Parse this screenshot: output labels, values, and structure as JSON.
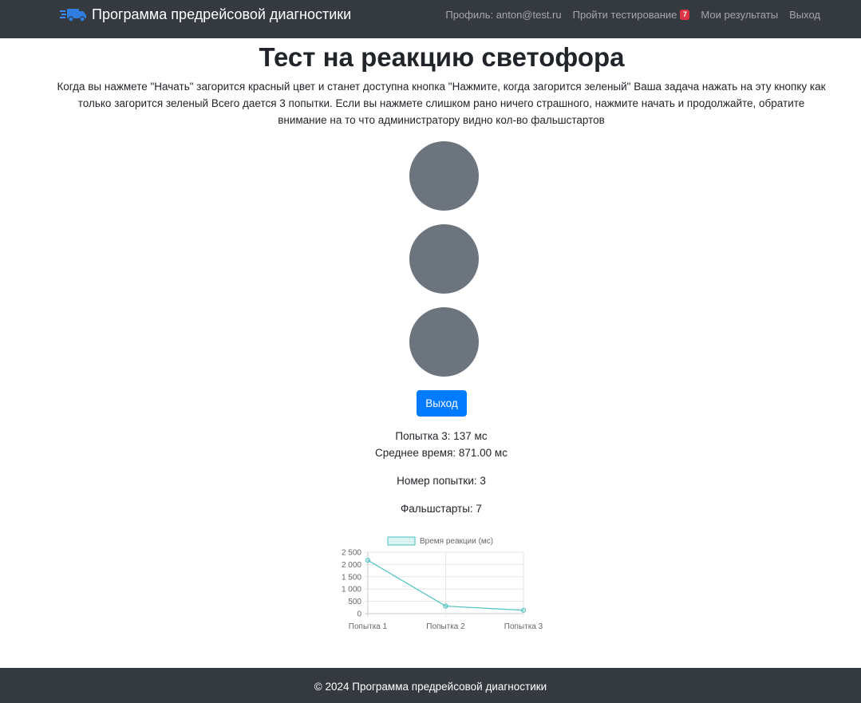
{
  "navbar": {
    "brand": "Программа предрейсовой диагностики",
    "brand_icon": "truck-icon",
    "profile": "Профиль: anton@test.ru",
    "take_test": "Пройти тестирование",
    "test_badge": "7",
    "my_results": "Мои результаты",
    "logout": "Выход",
    "badge_color": "#dc3545"
  },
  "main": {
    "title": "Тест на реакцию светофора",
    "description": "Когда вы нажмете \"Начать\" загорится красный цвет и станет доступна кнопка \"Нажмите, когда загорится зеленый\" Ваша задача нажать на эту кнопку как только загорится зеленый Всего дается 3 попытки. Если вы нажмете слишком рано ничего страшного, нажмите начать и продолжайте, обратите внимание на то что администратору видно кол-во фальшстартов",
    "light_color": "#6c757d",
    "exit_button": "Выход",
    "exit_button_color": "#007bff",
    "attempt_result": "Попытка 3: 137 мс",
    "average_time": "Среднее время: 871.00 мс",
    "attempt_number": "Номер попытки: 3",
    "false_starts": "Фальшстарты: 7"
  },
  "chart_data": {
    "type": "line",
    "categories": [
      "Попытка 1",
      "Попытка 2",
      "Попытка 3"
    ],
    "series": [
      {
        "name": "Время реакции (мс)",
        "values": [
          2170,
          306,
          137
        ],
        "color": "#4bc0c0"
      }
    ],
    "yticks": [
      "2 500",
      "2 000",
      "1 500",
      "1 000",
      "500",
      "0"
    ],
    "ylim": [
      0,
      2500
    ],
    "grid": true,
    "legend": "top"
  },
  "footer": {
    "text": "© 2024 Программа предрейсовой диагностики"
  }
}
